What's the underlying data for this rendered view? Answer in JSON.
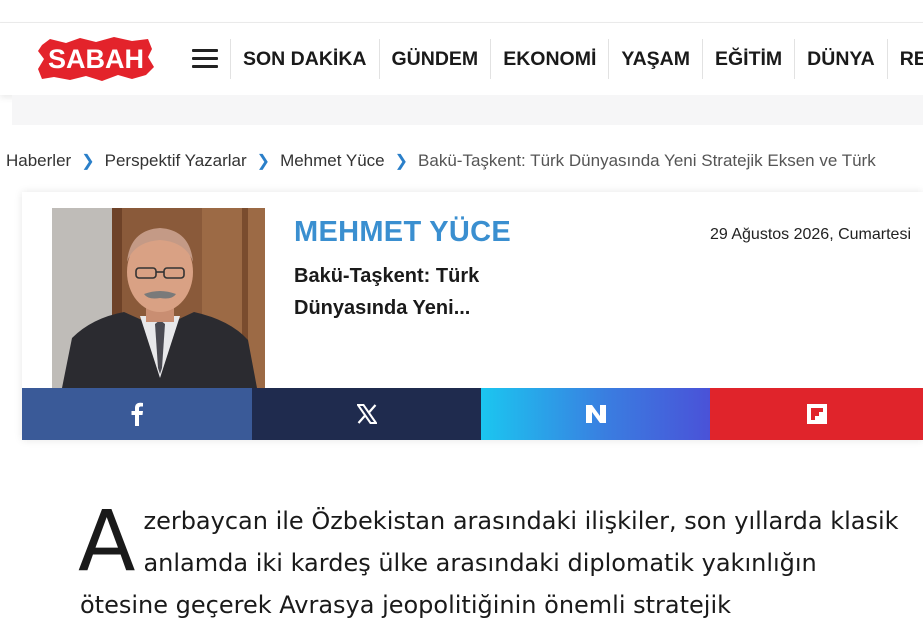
{
  "header": {
    "logo_text": "SABAH",
    "nav_items": [
      "SON DAKİKA",
      "GÜNDEM",
      "EKONOMİ",
      "YAŞAM",
      "EĞİTİM",
      "DÜNYA",
      "RE"
    ]
  },
  "breadcrumb": {
    "items": [
      "Haberler",
      "Perspektif Yazarlar",
      "Mehmet Yüce"
    ],
    "current": "Bakü-Taşkent: Türk Dünyasında Yeni Stratejik Eksen ve Türk"
  },
  "author_card": {
    "author_name": "MEHMET YÜCE",
    "article_title": "Bakü-Taşkent: Türk Dünyasında Yeni...",
    "date": "29 Ağustos 2026, Cumartesi"
  },
  "share": {
    "facebook_icon": "facebook-icon",
    "x_icon": "x-icon",
    "newsweek_icon": "n-icon",
    "flipboard_icon": "flipboard-icon"
  },
  "article": {
    "dropcap": "A",
    "text": "zerbaycan ile Özbekistan arasındaki ilişkiler, son yıllarda klasik anlamda iki kardeş ülke arasındaki diplomatik yakınlığın ötesine geçerek Avrasya jeopolitiğinin önemli stratejik"
  },
  "colors": {
    "brand_red": "#e3232b",
    "author_blue": "#3a8fd0",
    "facebook": "#3a5a98",
    "x": "#1f2b4e",
    "flipboard": "#e0242b"
  }
}
